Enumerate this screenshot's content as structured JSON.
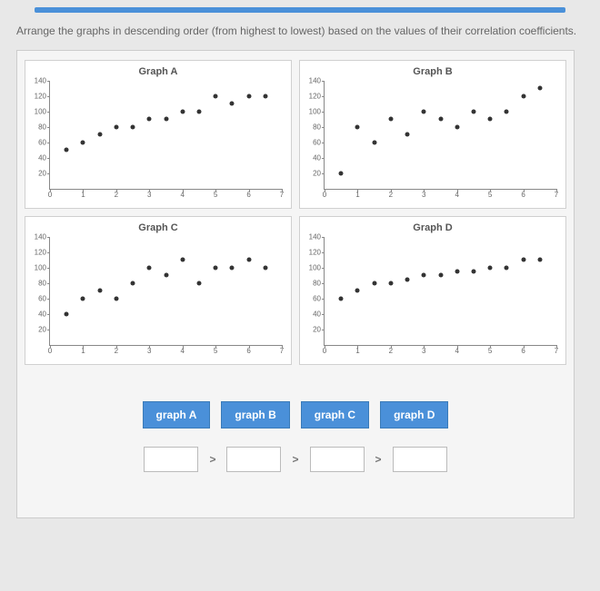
{
  "instructions": "Arrange the graphs in descending order (from highest to lowest) based on the values of their correlation coefficients.",
  "charts": {
    "a": {
      "title": "Graph A"
    },
    "b": {
      "title": "Graph B"
    },
    "c": {
      "title": "Graph C"
    },
    "d": {
      "title": "Graph D"
    }
  },
  "y_ticks": [
    "140",
    "120",
    "100",
    "80",
    "60",
    "40",
    "20"
  ],
  "x_ticks": [
    "0",
    "1",
    "2",
    "3",
    "4",
    "5",
    "6",
    "7"
  ],
  "tiles": {
    "a": "graph A",
    "b": "graph B",
    "c": "graph C",
    "d": "graph D"
  },
  "operators": {
    "gt": ">"
  },
  "chart_data": [
    {
      "type": "scatter",
      "title": "Graph A",
      "xlabel": "",
      "ylabel": "",
      "xlim": [
        0,
        7
      ],
      "ylim": [
        0,
        140
      ],
      "x": [
        0.5,
        1.0,
        1.5,
        2.0,
        2.5,
        3.0,
        3.5,
        4.0,
        4.5,
        5.0,
        5.5,
        6.0,
        6.5
      ],
      "y": [
        50,
        60,
        70,
        80,
        80,
        90,
        90,
        100,
        100,
        120,
        110,
        120,
        120
      ]
    },
    {
      "type": "scatter",
      "title": "Graph B",
      "xlabel": "",
      "ylabel": "",
      "xlim": [
        0,
        7
      ],
      "ylim": [
        0,
        140
      ],
      "x": [
        0.5,
        1.0,
        1.5,
        2.0,
        2.5,
        3.0,
        3.5,
        4.0,
        4.5,
        5.0,
        5.5,
        6.0,
        6.5
      ],
      "y": [
        20,
        80,
        60,
        90,
        70,
        100,
        90,
        80,
        100,
        90,
        100,
        120,
        130
      ]
    },
    {
      "type": "scatter",
      "title": "Graph C",
      "xlabel": "",
      "ylabel": "",
      "xlim": [
        0,
        7
      ],
      "ylim": [
        0,
        140
      ],
      "x": [
        0.5,
        1.0,
        1.5,
        2.0,
        2.5,
        3.0,
        3.5,
        4.0,
        4.5,
        5.0,
        5.5,
        6.0,
        6.5
      ],
      "y": [
        40,
        60,
        70,
        60,
        80,
        100,
        90,
        110,
        80,
        100,
        100,
        110,
        100
      ]
    },
    {
      "type": "scatter",
      "title": "Graph D",
      "xlabel": "",
      "ylabel": "",
      "xlim": [
        0,
        7
      ],
      "ylim": [
        0,
        140
      ],
      "x": [
        0.5,
        1.0,
        1.5,
        2.0,
        2.5,
        3.0,
        3.5,
        4.0,
        4.5,
        5.0,
        5.5,
        6.0,
        6.5
      ],
      "y": [
        60,
        70,
        80,
        80,
        85,
        90,
        90,
        95,
        95,
        100,
        100,
        110,
        110
      ]
    }
  ]
}
